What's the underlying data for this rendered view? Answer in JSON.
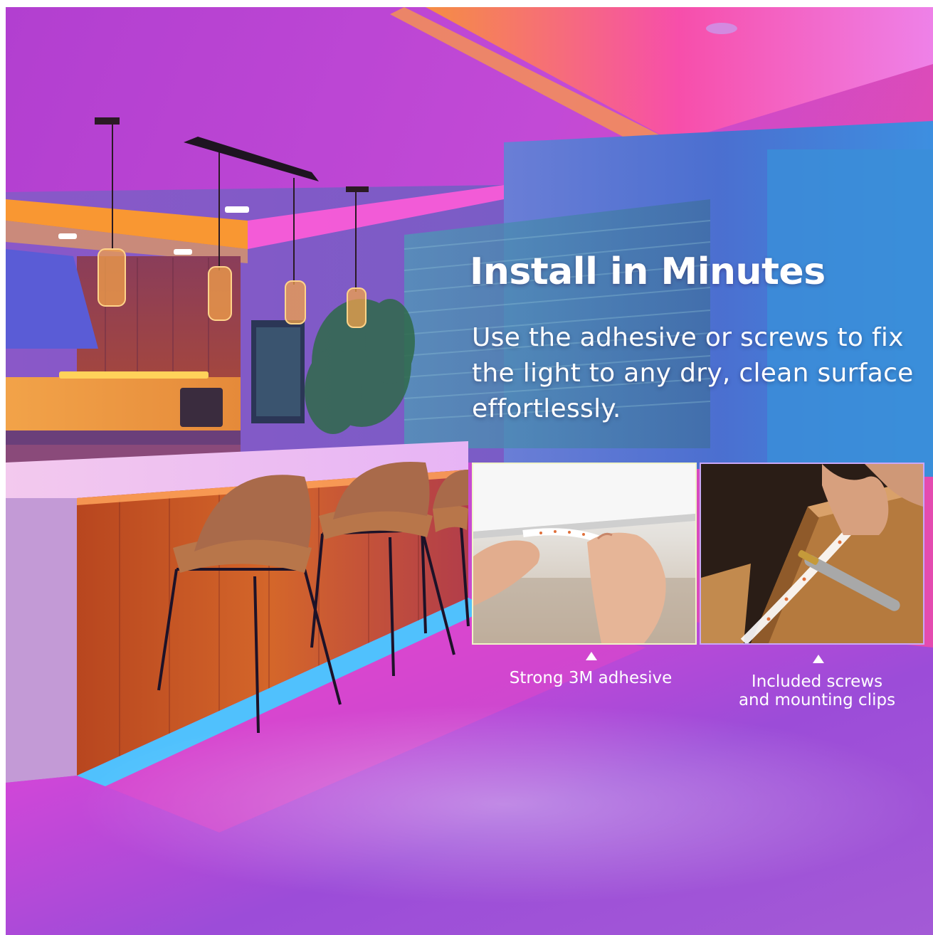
{
  "heading": "Install in Minutes",
  "description": "Use the adhesive or screws to fix the light to any dry, clean surface effortlessly.",
  "features": [
    {
      "caption": "Strong 3M adhesive",
      "icon": "adhesive-tape-photo"
    },
    {
      "caption_line1": "Included screws",
      "caption_line2": "and mounting clips",
      "icon": "screwdriver-photo"
    }
  ],
  "colors": {
    "magenta": "#d63bd8",
    "orange": "#ff8a2a",
    "cyan": "#3ecbff",
    "purple": "#9b4fd8"
  }
}
